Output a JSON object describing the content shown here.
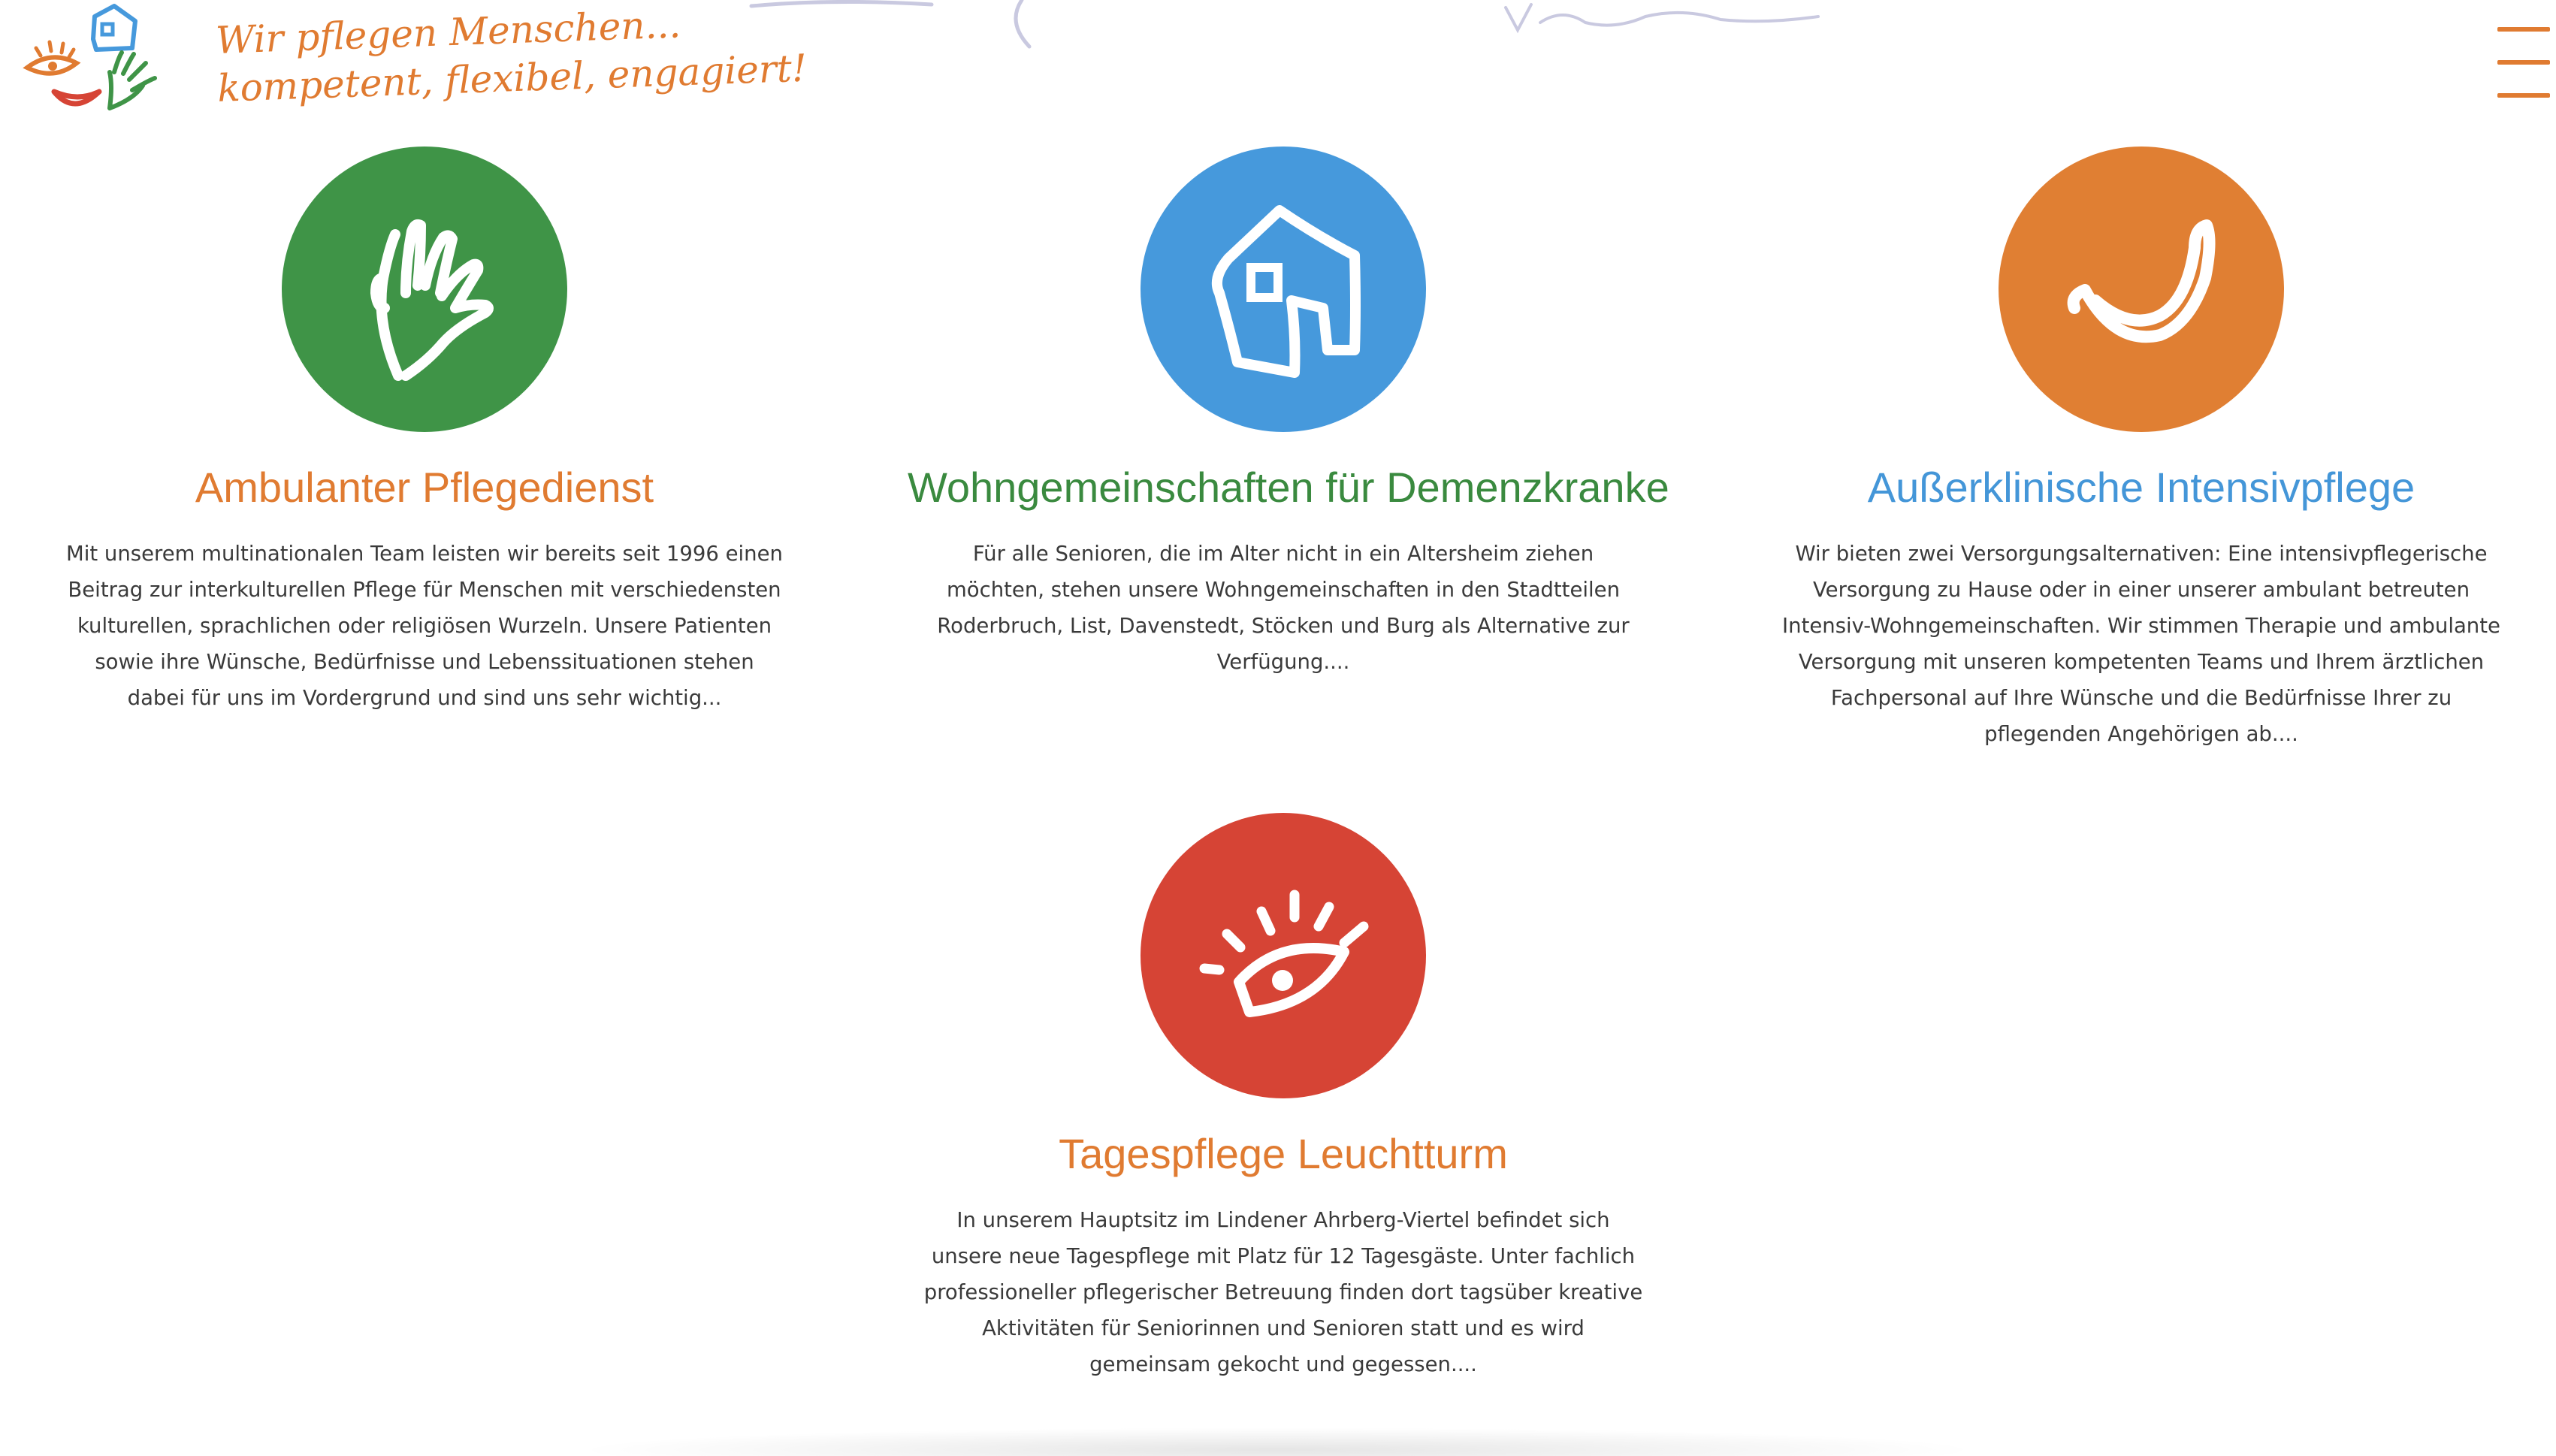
{
  "header": {
    "logo_name": "hand-eye-house-logo",
    "tagline_line1": "Wir pflegen Menschen...",
    "tagline_line2": "kompetent, flexibel, engagiert!",
    "menu_icon": "hamburger-icon"
  },
  "services": [
    {
      "title": "Ambulanter Pflegedienst",
      "text": "Mit unserem multinationalen Team leisten wir bereits seit 1996 einen Beitrag zur interkulturellen Pflege für Menschen mit verschiedensten kulturellen, sprachlichen oder religiösen Wurzeln. Unsere Patienten sowie ihre Wünsche, Bedürfnisse und Lebenssituationen stehen dabei für uns im Vordergrund und sind uns sehr wichtig...",
      "icon": "hand-icon",
      "circle_color": "#3f9447",
      "title_color": "#e07b31"
    },
    {
      "title": "Wohngemeinschaften für Demenzkranke",
      "text": "Für alle Senioren, die im Alter nicht in ein Altersheim ziehen möchten, stehen unsere Wohngemeinschaften in den Stadtteilen Roderbruch, List, Davenstedt, Stöcken und Burg als Alternative zur Verfügung....",
      "icon": "house-icon",
      "circle_color": "#4699dc",
      "title_color": "#3a8a3f"
    },
    {
      "title": "Außerklinische Intensivpflege",
      "text": "Wir bieten zwei Versorgungsalternativen: Eine intensivpflegerische Versorgung zu Hause oder in einer unserer ambulant betreuten Intensiv-Wohngemeinschaften. Wir stimmen Therapie und ambulante Versorgung mit unseren kompetenten Teams und Ihrem ärztlichen Fachpersonal auf Ihre Wünsche und die Bedürfnisse Ihrer zu pflegenden Angehörigen ab....",
      "icon": "smile-mouth-icon",
      "circle_color": "#e07f33",
      "title_color": "#4496d8"
    },
    {
      "title": "Tagespflege Leuchtturm",
      "text": "In unserem Hauptsitz im Lindener Ahrberg-Viertel befindet sich unsere neue Tagespflege mit Platz für 12 Tagesgäste. Unter fachlich professioneller pflegerischer Betreuung finden dort tagsüber kreative Aktivitäten für Seniorinnen und Senioren statt und es wird gemeinsam gekocht und gegessen....",
      "icon": "eye-icon",
      "circle_color": "#d64435",
      "title_color": "#e07b31"
    }
  ]
}
